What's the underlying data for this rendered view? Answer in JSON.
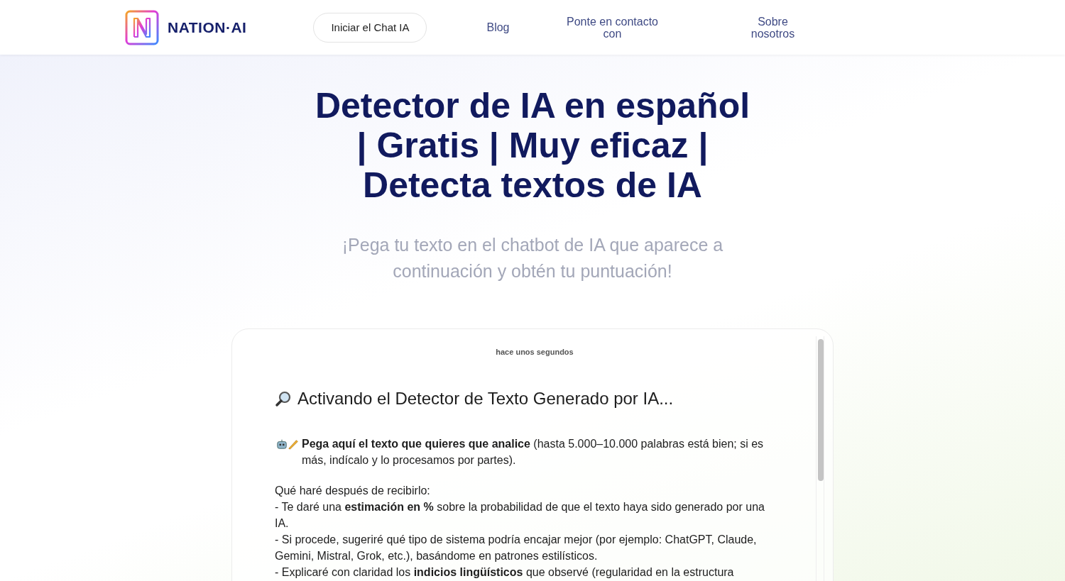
{
  "header": {
    "brand": "NATION·AI",
    "cta": "Iniciar el Chat IA",
    "nav": [
      {
        "label": "Blog"
      },
      {
        "label": "Ponte en contacto con"
      },
      {
        "label": "Sobre nosotros"
      }
    ]
  },
  "hero": {
    "title": "Detector de IA en español | Gratis | Muy eficaz | Detecta textos de IA",
    "subtitle": "¡Pega tu texto en el chatbot de IA que aparece a continuación y obtén tu puntuación!"
  },
  "chat": {
    "timestamp": "hace unos segundos",
    "heading": "Activando el Detector de Texto Generado por IA...",
    "intro": "**Pega aquí el texto que quieres que analice** (hasta 5.000–10.000 palabras está bien; si es más, indícalo y lo procesamos por partes).",
    "lines": [
      "Qué haré después de recibirlo:",
      "- Te daré una **estimación en %** sobre la probabilidad de que el texto haya sido generado por una IA.",
      "- Si procede, sugeriré qué tipo de sistema podría encajar mejor (por ejemplo: ChatGPT, Claude, Gemini, Mistral, Grok, etc.), basándome en patrones estilísticos.",
      "- Explicaré con claridad los **indicios lingüísticos** que observé (regularidad en la estructura"
    ]
  }
}
